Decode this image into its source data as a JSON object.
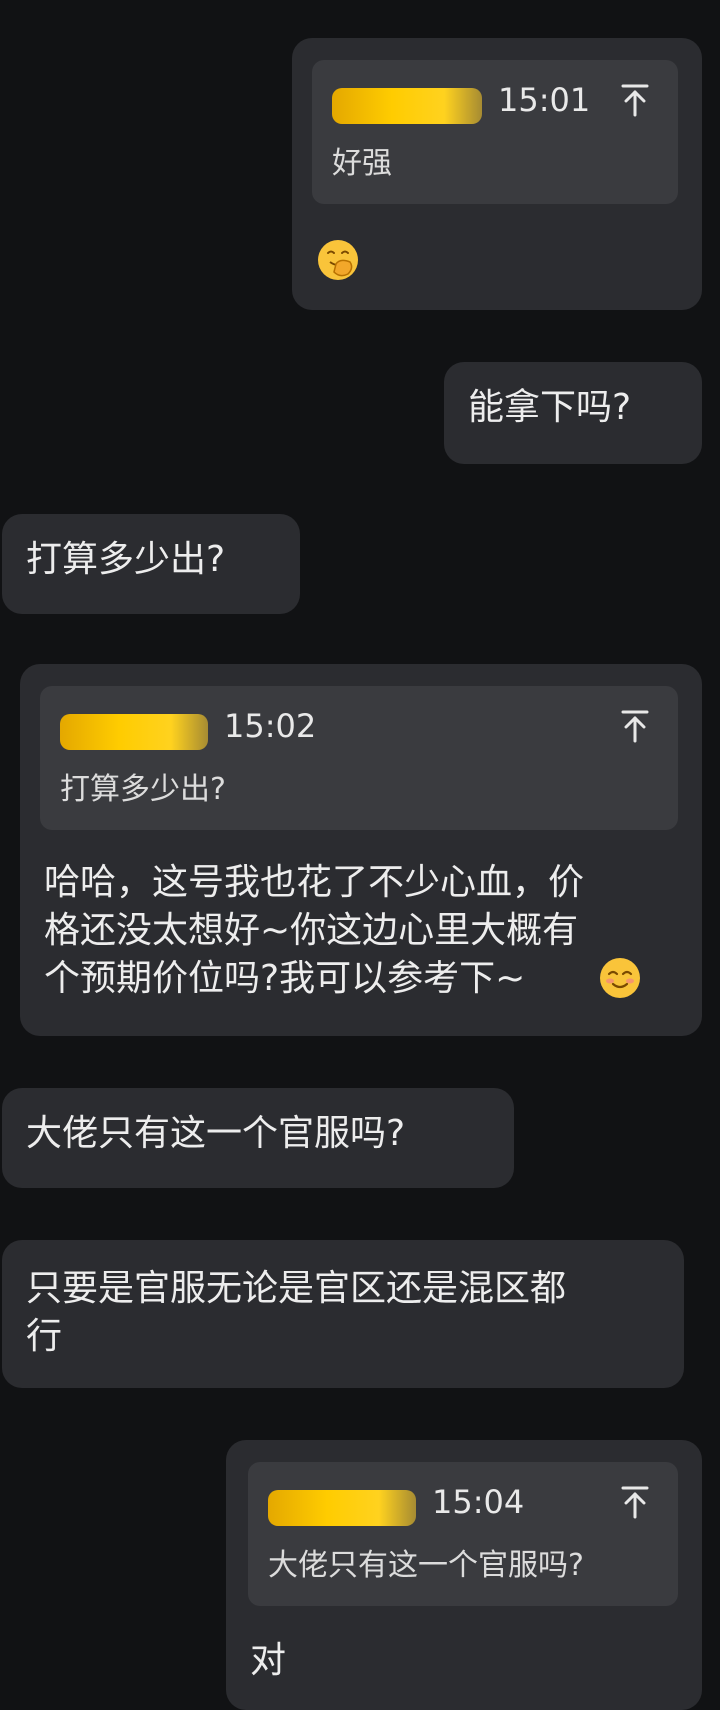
{
  "messages": [
    {
      "side": "right",
      "quote": {
        "time": "15:01",
        "text": "好强"
      },
      "reply_emoji": "hand-over-mouth-emoji"
    },
    {
      "side": "right",
      "text": "能拿下吗?"
    },
    {
      "side": "left",
      "text": "打算多少出?"
    },
    {
      "side": "right",
      "quote": {
        "time": "15:02",
        "text": "打算多少出?"
      },
      "reply_lines": [
        "哈哈，这号我也花了不少心血，价",
        "格还没太想好~你这边心里大概有",
        "个预期价位吗?我可以参考下~"
      ],
      "reply_emoji": "smiling-face-emoji"
    },
    {
      "side": "left",
      "text": "大佬只有这一个官服吗?"
    },
    {
      "side": "left",
      "lines": [
        "只要是官服无论是官区还是混区都",
        "行"
      ]
    },
    {
      "side": "right",
      "quote": {
        "time": "15:04",
        "text": "大佬只有这一个官服吗?"
      },
      "reply_text": "对"
    }
  ],
  "colors": {
    "background": "#111214",
    "bubble": "#2b2c30",
    "quote_box": "#3a3b3f",
    "redaction": "#ffcc00"
  }
}
